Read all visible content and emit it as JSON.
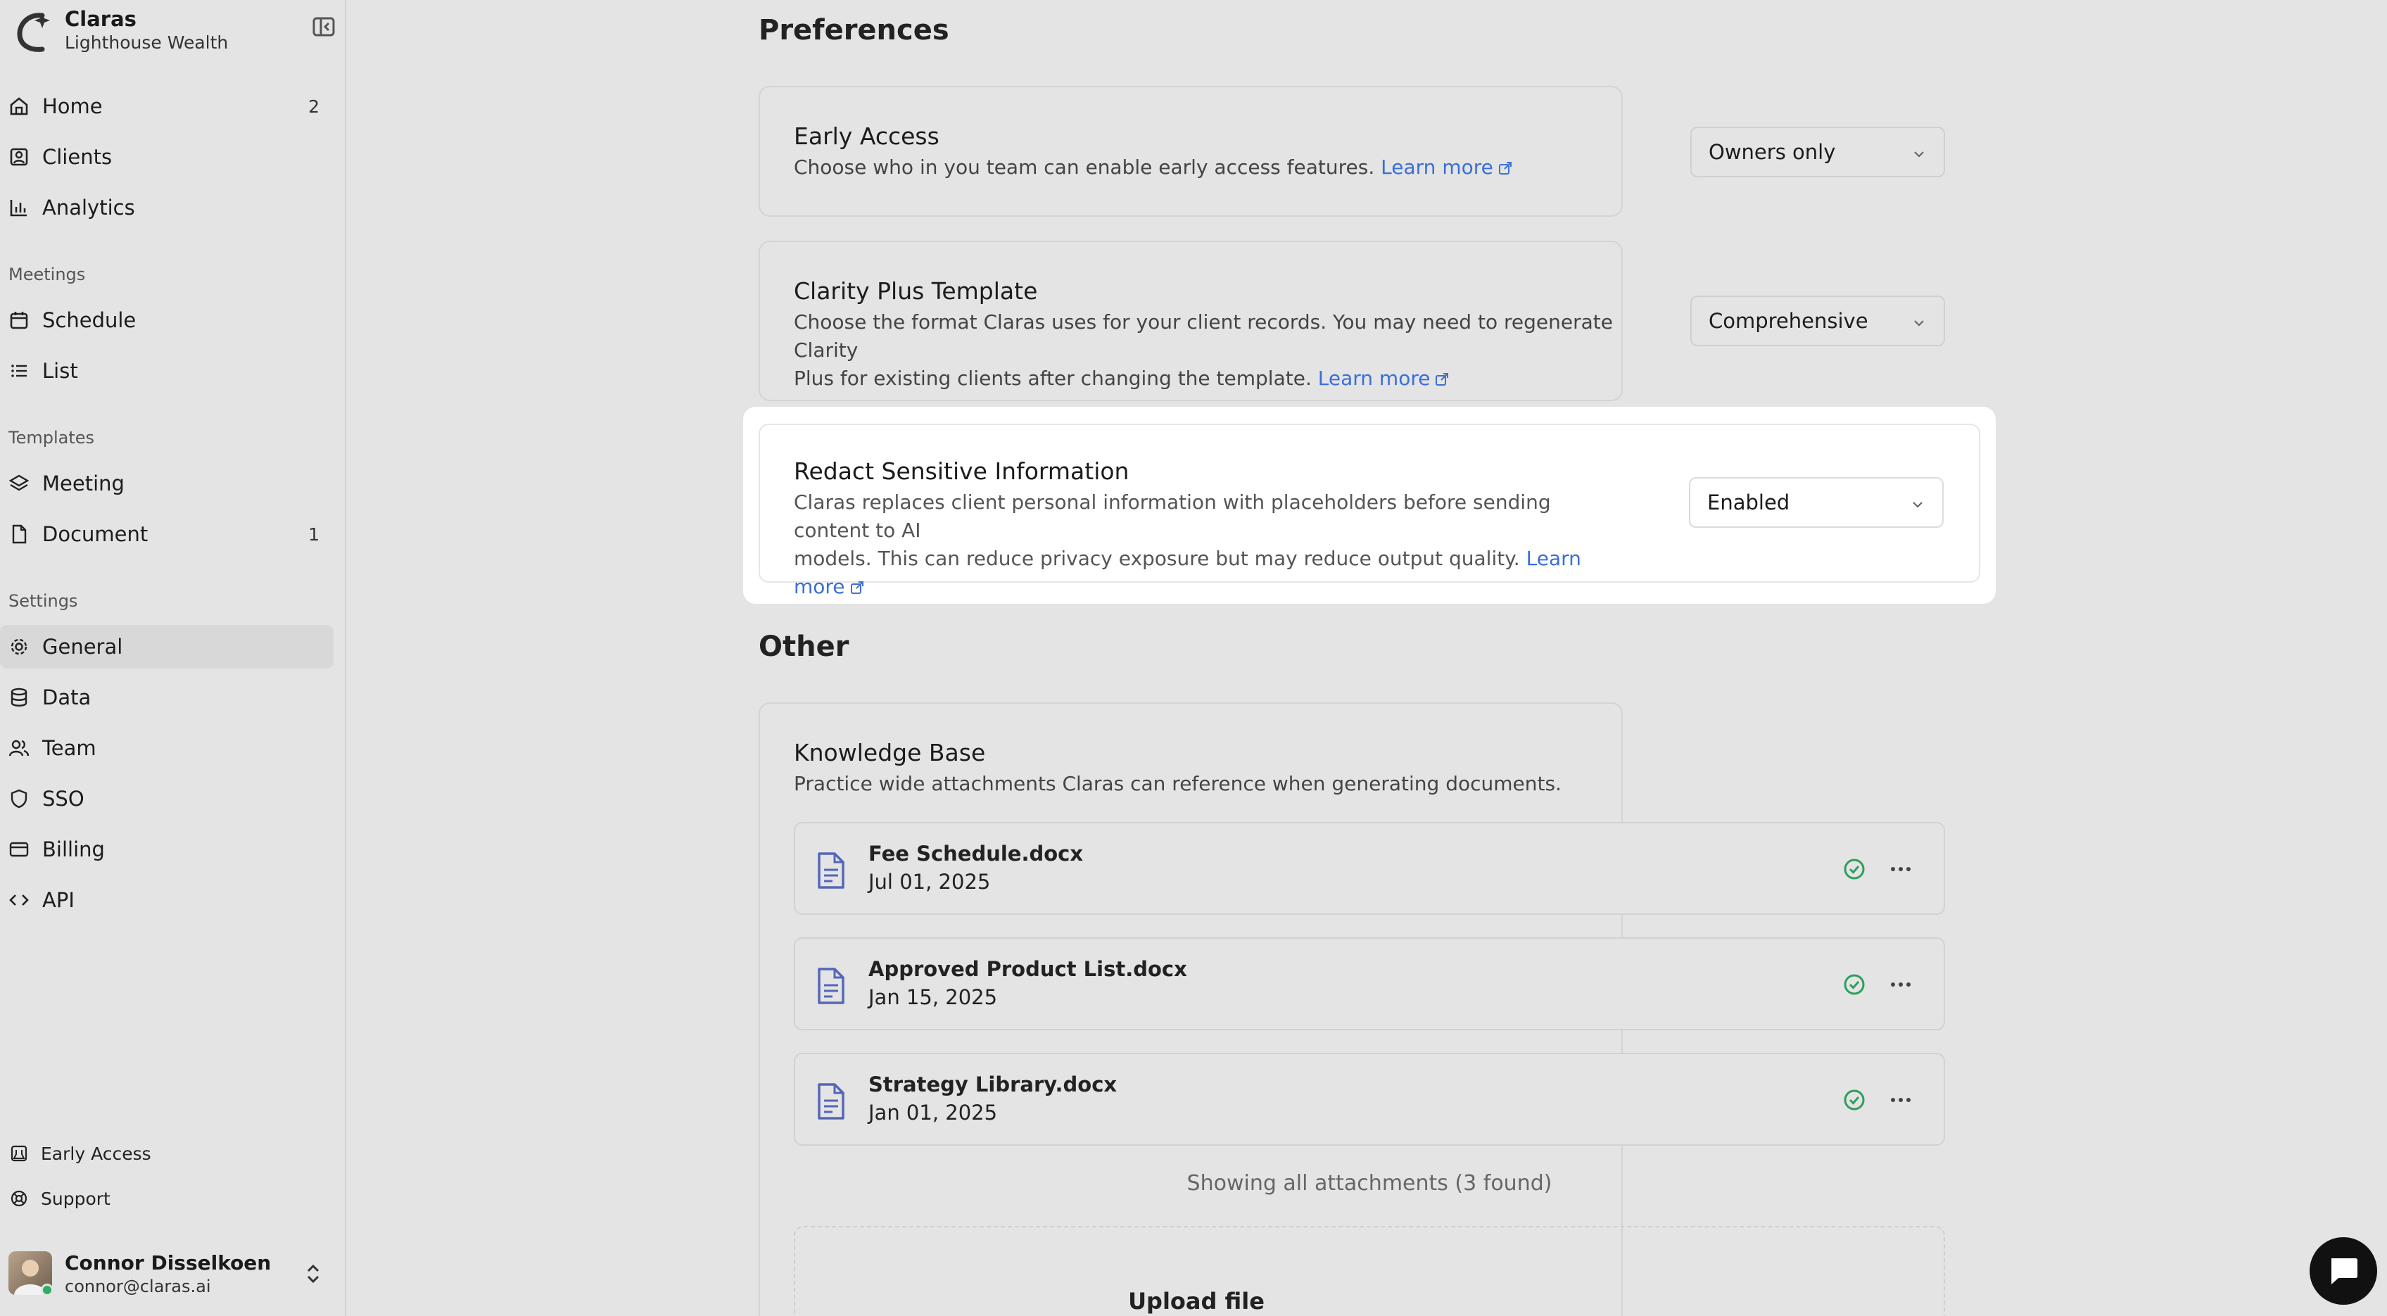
{
  "sidebar": {
    "brand_name": "Claras",
    "org_name": "Lighthouse Wealth",
    "main_items": [
      {
        "label": "Home",
        "count": "2"
      },
      {
        "label": "Clients"
      },
      {
        "label": "Analytics"
      }
    ],
    "meetings_title": "Meetings",
    "meetings_items": [
      {
        "label": "Schedule"
      },
      {
        "label": "List"
      }
    ],
    "templates_title": "Templates",
    "templates_items": [
      {
        "label": "Meeting"
      },
      {
        "label": "Document",
        "count": "1"
      }
    ],
    "settings_title": "Settings",
    "settings_items": [
      {
        "label": "General",
        "active": true
      },
      {
        "label": "Data"
      },
      {
        "label": "Team"
      },
      {
        "label": "SSO"
      },
      {
        "label": "Billing"
      },
      {
        "label": "API"
      }
    ],
    "bottom_items": [
      {
        "label": "Early Access"
      },
      {
        "label": "Support"
      }
    ],
    "user": {
      "name": "Connor Disselkoen",
      "email": "connor@claras.ai"
    }
  },
  "preferences": {
    "title": "Preferences",
    "early_access": {
      "title": "Early Access",
      "desc": "Choose who in you team can enable early access features.",
      "link": "Learn more",
      "value": "Owners only"
    },
    "clarity_plus": {
      "title": "Clarity Plus Template",
      "desc_1": "Choose the format Claras uses for your client records. You may need to regenerate Clarity",
      "desc_2": "Plus for existing clients after changing the template.",
      "link": "Learn more",
      "value": "Comprehensive"
    },
    "redact": {
      "title": "Redact Sensitive Information",
      "desc_1": "Claras replaces client personal information with placeholders before sending content to AI",
      "desc_2": "models. This can reduce privacy exposure but may reduce output quality.",
      "link": "Learn more",
      "value": "Enabled"
    }
  },
  "other": {
    "title": "Other",
    "knowledge_base": {
      "title": "Knowledge Base",
      "desc": "Practice wide attachments Claras can reference when generating documents.",
      "files": [
        {
          "name": "Fee Schedule.docx",
          "date": "Jul 01, 2025"
        },
        {
          "name": "Approved Product List.docx",
          "date": "Jan 15, 2025"
        },
        {
          "name": "Strategy Library.docx",
          "date": "Jan 01, 2025"
        }
      ],
      "count_text": "Showing all attachments (3 found)",
      "upload_label": "Upload file"
    }
  },
  "colors": {
    "accent_link": "#3b6fd6",
    "success": "#2f9e5e",
    "file_icon": "#5566b8"
  }
}
